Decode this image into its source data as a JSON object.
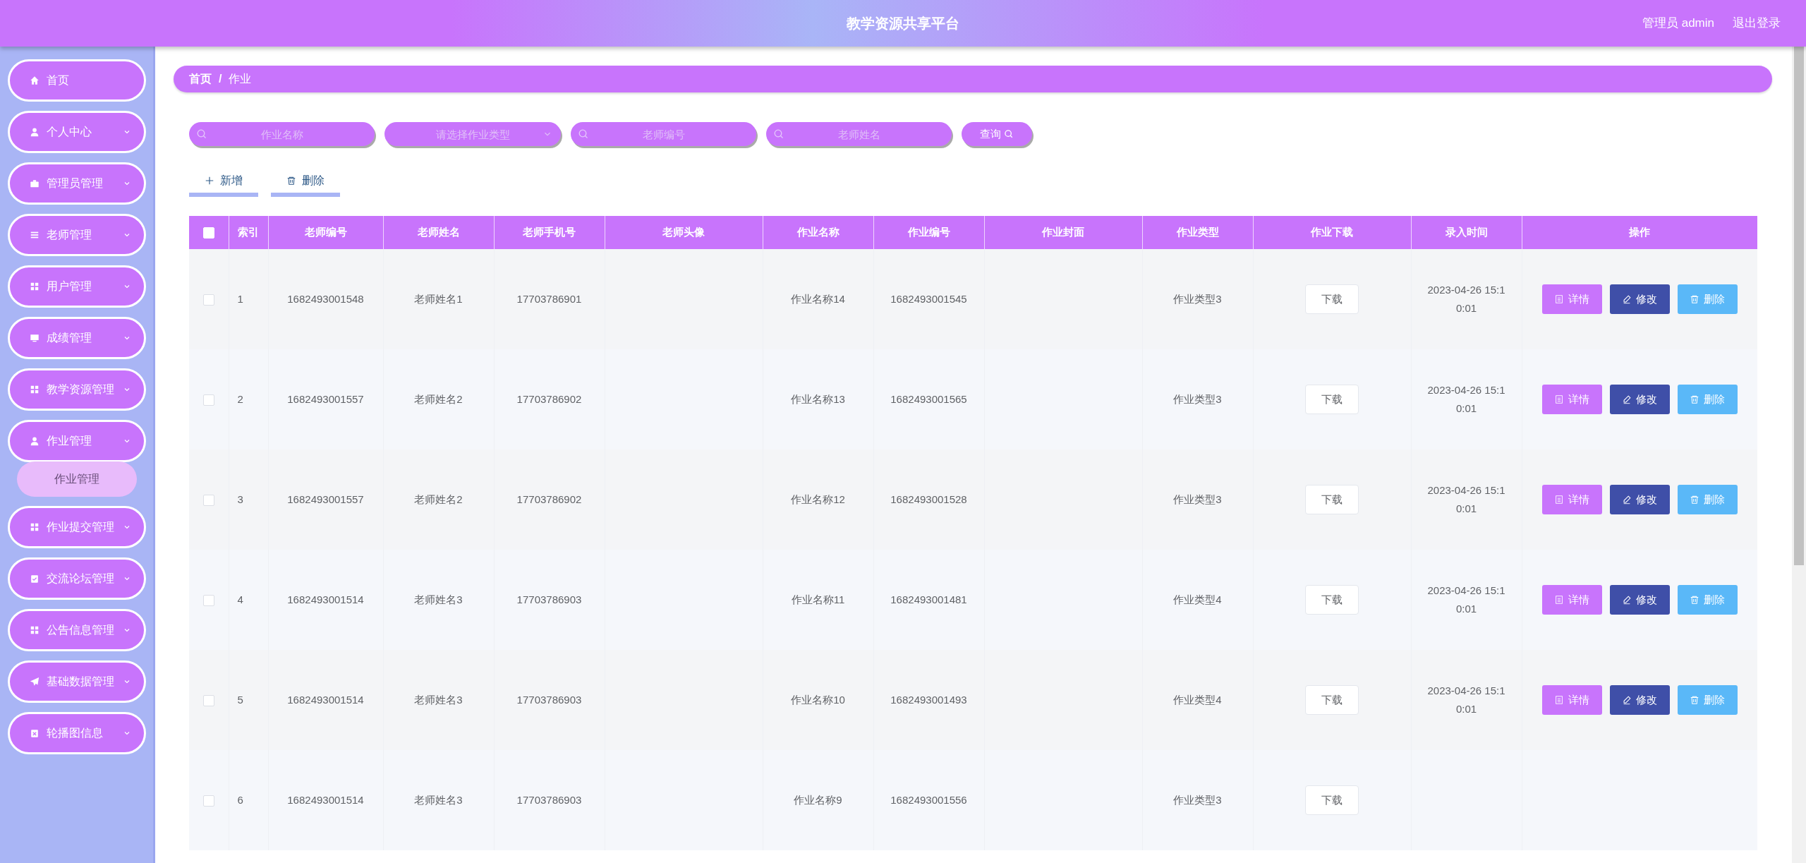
{
  "header": {
    "title": "教学资源共享平台",
    "user": "管理员 admin",
    "logout": "退出登录"
  },
  "sidebar": {
    "items": [
      {
        "label": "首页",
        "has_arrow": false
      },
      {
        "label": "个人中心",
        "has_arrow": true
      },
      {
        "label": "管理员管理",
        "has_arrow": true
      },
      {
        "label": "老师管理",
        "has_arrow": true
      },
      {
        "label": "用户管理",
        "has_arrow": true
      },
      {
        "label": "成绩管理",
        "has_arrow": true
      },
      {
        "label": "教学资源管理",
        "has_arrow": true
      },
      {
        "label": "作业管理",
        "has_arrow": true,
        "children": [
          {
            "label": "作业管理"
          }
        ]
      },
      {
        "label": "作业提交管理",
        "has_arrow": true
      },
      {
        "label": "交流论坛管理",
        "has_arrow": true
      },
      {
        "label": "公告信息管理",
        "has_arrow": true
      },
      {
        "label": "基础数据管理",
        "has_arrow": true
      },
      {
        "label": "轮播图信息",
        "has_arrow": true
      }
    ]
  },
  "breadcrumb": {
    "items": [
      "首页",
      "作业"
    ],
    "separator": "/"
  },
  "search": {
    "fields": [
      {
        "kind": "text",
        "placeholder": "作业名称"
      },
      {
        "kind": "select",
        "placeholder": "请选择作业类型"
      },
      {
        "kind": "text",
        "placeholder": "老师编号"
      },
      {
        "kind": "text",
        "placeholder": "老师姓名"
      }
    ],
    "button": "查询"
  },
  "toolbar": [
    {
      "kind": "add",
      "label": "新增"
    },
    {
      "kind": "delete",
      "label": "删除"
    }
  ],
  "table": {
    "all_checked": false,
    "columns": [
      "索引",
      "老师编号",
      "老师姓名",
      "老师手机号",
      "老师头像",
      "作业名称",
      "作业编号",
      "作业封面",
      "作业类型",
      "作业下载",
      "录入时间",
      "操作"
    ],
    "rows": [
      {
        "selected": false,
        "cells": [
          "1",
          "1682493001548",
          "老师姓名1",
          "17703786901",
          "",
          "作业名称14",
          "1682493001545",
          "",
          "作业类型3"
        ],
        "download": "下载",
        "time": "2023-04-26 15:10:01",
        "actions": [
          "详情",
          "修改",
          "删除"
        ]
      },
      {
        "selected": false,
        "cells": [
          "2",
          "1682493001557",
          "老师姓名2",
          "17703786902",
          "",
          "作业名称13",
          "1682493001565",
          "",
          "作业类型3"
        ],
        "download": "下载",
        "time": "2023-04-26 15:10:01",
        "actions": [
          "详情",
          "修改",
          "删除"
        ]
      },
      {
        "selected": false,
        "cells": [
          "3",
          "1682493001557",
          "老师姓名2",
          "17703786902",
          "",
          "作业名称12",
          "1682493001528",
          "",
          "作业类型3"
        ],
        "download": "下载",
        "time": "2023-04-26 15:10:01",
        "actions": [
          "详情",
          "修改",
          "删除"
        ]
      },
      {
        "selected": false,
        "cells": [
          "4",
          "1682493001514",
          "老师姓名3",
          "17703786903",
          "",
          "作业名称11",
          "1682493001481",
          "",
          "作业类型4"
        ],
        "download": "下载",
        "time": "2023-04-26 15:10:01",
        "actions": [
          "详情",
          "修改",
          "删除"
        ]
      },
      {
        "selected": false,
        "cells": [
          "5",
          "1682493001514",
          "老师姓名3",
          "17703786903",
          "",
          "作业名称10",
          "1682493001493",
          "",
          "作业类型4"
        ],
        "download": "下载",
        "time": "2023-04-26 15:10:01",
        "actions": [
          "详情",
          "修改",
          "删除"
        ]
      },
      {
        "selected": false,
        "cells": [
          "6",
          "1682493001514",
          "老师姓名3",
          "17703786903",
          "",
          "作业名称9",
          "1682493001556",
          "",
          "作业类型3"
        ],
        "download": "下载"
      }
    ]
  }
}
